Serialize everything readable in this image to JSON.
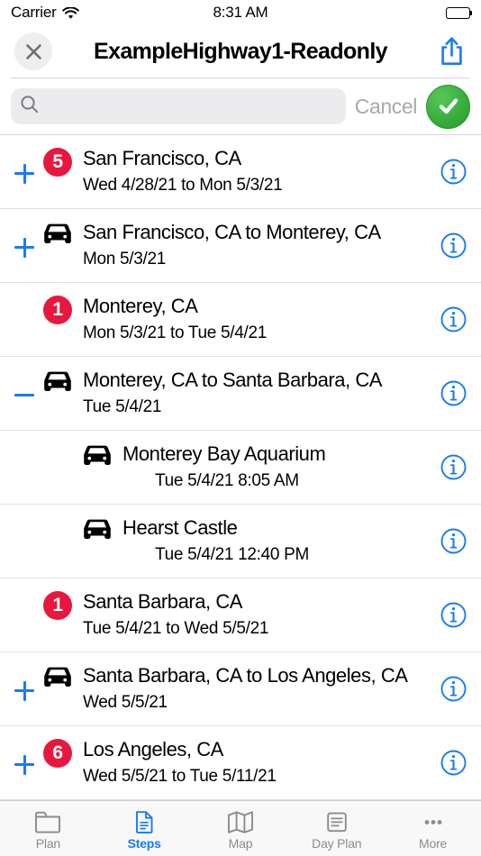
{
  "statusbar": {
    "carrier": "Carrier",
    "time": "8:31 AM",
    "wifi_icon": "wifi-icon",
    "battery_icon": "battery-full-icon"
  },
  "navbar": {
    "title": "ExampleHighway1-Readonly",
    "close_icon": "close-icon",
    "share_icon": "share-icon"
  },
  "search": {
    "value": "",
    "placeholder": "",
    "search_icon": "search-icon",
    "cancel_label": "Cancel",
    "confirm_icon": "checkmark-circle-icon",
    "confirm_color": "#36ad3b"
  },
  "colors": {
    "accent_blue": "#1a7bf2",
    "badge_red": "#e8173d",
    "inactive_gray": "#8b8b90"
  },
  "list": {
    "rows": [
      {
        "toggle": "plus",
        "icon": "badge",
        "badge": "5",
        "title": "San Francisco, CA",
        "subtitle": "Wed 4/28/21 to Mon 5/3/21",
        "info_icon": "info-icon",
        "indent": false
      },
      {
        "toggle": "plus",
        "icon": "car",
        "badge": "",
        "title": "San Francisco, CA to Monterey, CA",
        "subtitle": "Mon 5/3/21",
        "info_icon": "info-icon",
        "indent": false
      },
      {
        "toggle": "none",
        "icon": "badge",
        "badge": "1",
        "title": "Monterey, CA",
        "subtitle": "Mon 5/3/21 to Tue 5/4/21",
        "info_icon": "info-icon",
        "indent": false
      },
      {
        "toggle": "minus",
        "icon": "car",
        "badge": "",
        "title": "Monterey, CA to Santa Barbara, CA",
        "subtitle": "Tue 5/4/21",
        "info_icon": "info-icon",
        "indent": false
      },
      {
        "toggle": "none",
        "icon": "car",
        "badge": "",
        "title": "Monterey Bay Aquarium",
        "subtitle": "Tue 5/4/21 8:05 AM",
        "info_icon": "info-icon",
        "indent": true
      },
      {
        "toggle": "none",
        "icon": "car",
        "badge": "",
        "title": "Hearst Castle",
        "subtitle": "Tue 5/4/21 12:40 PM",
        "info_icon": "info-icon",
        "indent": true
      },
      {
        "toggle": "none",
        "icon": "badge",
        "badge": "1",
        "title": "Santa Barbara, CA",
        "subtitle": "Tue 5/4/21 to Wed 5/5/21",
        "info_icon": "info-icon",
        "indent": false
      },
      {
        "toggle": "plus",
        "icon": "car",
        "badge": "",
        "title": "Santa Barbara, CA to Los Angeles, CA",
        "subtitle": "Wed 5/5/21",
        "info_icon": "info-icon",
        "indent": false
      },
      {
        "toggle": "plus",
        "icon": "badge",
        "badge": "6",
        "title": "Los Angeles, CA",
        "subtitle": "Wed 5/5/21 to Tue 5/11/21",
        "info_icon": "info-icon",
        "indent": false
      }
    ]
  },
  "tabbar": {
    "tabs": [
      {
        "label": "Plan",
        "icon": "folder-icon",
        "active": false
      },
      {
        "label": "Steps",
        "icon": "document-icon",
        "active": true
      },
      {
        "label": "Map",
        "icon": "map-icon",
        "active": false
      },
      {
        "label": "Day Plan",
        "icon": "list-icon",
        "active": false
      },
      {
        "label": "More",
        "icon": "ellipsis-icon",
        "active": false
      }
    ]
  }
}
